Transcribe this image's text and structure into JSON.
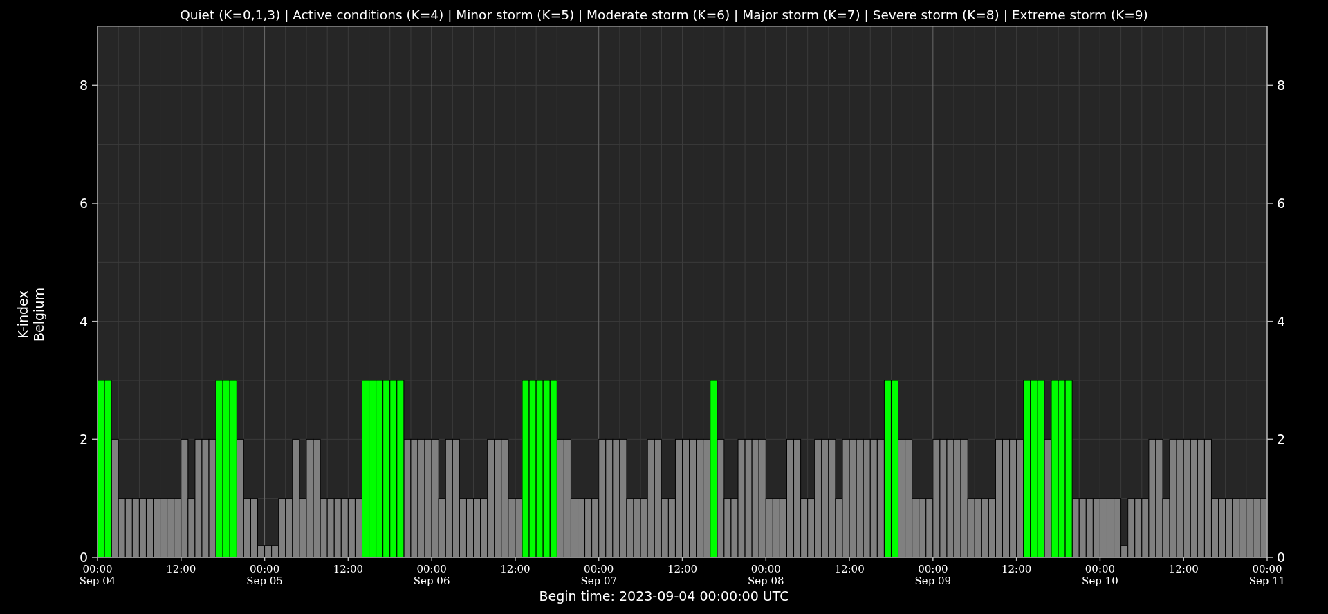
{
  "chart": {
    "chart_data": {
      "type": "bar",
      "title": "Quiet (K=0,1,3) | Active conditions (K=4) | Minor storm (K=5) | Moderate storm (K=6) | Major storm (K=7) | Severe storm (K=8) | Extreme storm (K=9)",
      "xlabel": "Begin time: 2023-09-04 00:00:00 UTC",
      "ylabel": "K-index\nBelgium",
      "stacked": true,
      "grid": true,
      "ylim": [
        0,
        9
      ],
      "yticks": [
        0,
        2,
        4,
        6,
        8
      ],
      "categories": [
        "00:00\nSep 04",
        null,
        null,
        null,
        null,
        null,
        null,
        null,
        null,
        null,
        null,
        null,
        "12:00",
        null,
        null,
        null,
        null,
        null,
        null,
        null,
        null,
        null,
        null,
        null,
        "00:00\nSep 05",
        null,
        null,
        null,
        null,
        null,
        null,
        null,
        null,
        null,
        null,
        null,
        "12:00",
        null,
        null,
        null,
        null,
        null,
        null,
        null,
        null,
        null,
        null,
        null,
        "00:00\nSep 06",
        null,
        null,
        null,
        null,
        null,
        null,
        null,
        null,
        null,
        null,
        null,
        "12:00",
        null,
        null,
        null,
        null,
        null,
        null,
        null,
        null,
        null,
        null,
        null,
        "00:00\nSep 07",
        null,
        null,
        null,
        null,
        null,
        null,
        null,
        null,
        null,
        null,
        null,
        "12:00",
        null,
        null,
        null,
        null,
        null,
        null,
        null,
        null,
        null,
        null,
        null,
        "00:00\nSep 08",
        null,
        null,
        null,
        null,
        null,
        null,
        null,
        null,
        null,
        null,
        null,
        "12:00",
        null,
        null,
        null,
        null,
        null,
        null,
        null,
        null,
        null,
        null,
        null,
        "00:00\nSep 09",
        null,
        null,
        null,
        null,
        null,
        null,
        null,
        null,
        null,
        null,
        null,
        "12:00",
        null,
        null,
        null,
        null,
        null,
        null,
        null,
        null,
        null,
        null,
        null,
        "00:00\nSep 10",
        null,
        null,
        null,
        null,
        null,
        null,
        null,
        null,
        null,
        null,
        null,
        "12:00",
        null,
        null,
        null,
        null,
        null,
        null,
        null,
        null,
        null,
        null,
        null
      ],
      "series": [
        {
          "color": "#808080",
          "values": [
            null,
            null,
            2,
            1,
            1,
            1,
            1,
            1,
            1,
            1,
            1,
            1,
            2,
            1,
            2,
            2,
            2,
            null,
            null,
            null,
            2,
            1,
            1,
            0.2,
            0.2,
            0.2,
            1,
            1,
            2,
            1,
            2,
            2,
            1,
            1,
            1,
            1,
            1,
            1,
            null,
            null,
            null,
            null,
            null,
            null,
            2,
            2,
            2,
            2,
            2,
            1,
            2,
            2,
            1,
            1,
            1,
            1,
            2,
            2,
            2,
            1,
            1,
            null,
            null,
            null,
            null,
            null,
            2,
            2,
            1,
            1,
            1,
            1,
            2,
            2,
            2,
            2,
            1,
            1,
            1,
            2,
            2,
            1,
            1,
            2,
            2,
            2,
            2,
            2,
            null,
            2,
            1,
            1,
            2,
            2,
            2,
            2,
            1,
            1,
            1,
            2,
            2,
            1,
            1,
            2,
            2,
            2,
            1,
            2,
            2,
            2,
            2,
            2,
            2,
            null,
            null,
            2,
            2,
            1,
            1,
            1,
            2,
            2,
            2,
            2,
            2,
            1,
            1,
            1,
            1,
            2,
            2,
            2,
            2,
            null,
            null,
            null,
            2,
            null,
            null,
            null,
            1,
            1,
            1,
            1,
            1,
            1,
            1,
            0.2,
            1,
            1,
            1,
            2,
            2,
            1,
            2,
            2,
            2,
            2,
            2,
            2,
            1,
            1,
            1,
            1,
            1,
            1,
            1,
            1
          ]
        },
        {
          "color": "#00ff00",
          "values": [
            3,
            3,
            null,
            null,
            null,
            null,
            null,
            null,
            null,
            null,
            null,
            null,
            null,
            null,
            null,
            null,
            null,
            3,
            3,
            3,
            null,
            null,
            null,
            null,
            null,
            null,
            null,
            null,
            null,
            null,
            null,
            null,
            null,
            null,
            null,
            null,
            null,
            null,
            3,
            3,
            3,
            3,
            3,
            3,
            null,
            null,
            null,
            null,
            null,
            null,
            null,
            null,
            null,
            null,
            null,
            null,
            null,
            null,
            null,
            null,
            null,
            3,
            3,
            3,
            3,
            3,
            null,
            null,
            null,
            null,
            null,
            null,
            null,
            null,
            null,
            null,
            null,
            null,
            null,
            null,
            null,
            null,
            null,
            null,
            null,
            null,
            null,
            null,
            3,
            null,
            null,
            null,
            null,
            null,
            null,
            null,
            null,
            null,
            null,
            null,
            null,
            null,
            null,
            null,
            null,
            null,
            null,
            null,
            null,
            null,
            null,
            null,
            null,
            3,
            3,
            null,
            null,
            null,
            null,
            null,
            null,
            null,
            null,
            null,
            null,
            null,
            null,
            null,
            null,
            null,
            null,
            null,
            null,
            3,
            3,
            3,
            null,
            3,
            3,
            3,
            null,
            null,
            null,
            null,
            null,
            null,
            null,
            null,
            null,
            null,
            null,
            null,
            null,
            null,
            null,
            null,
            null,
            null,
            null,
            null,
            null,
            null,
            null,
            null,
            null,
            null,
            null,
            null
          ]
        }
      ]
    },
    "x_end_label": "00:00\nSep 11",
    "right_axis_labels": [
      "8",
      "6",
      "4",
      "2",
      "0"
    ]
  }
}
